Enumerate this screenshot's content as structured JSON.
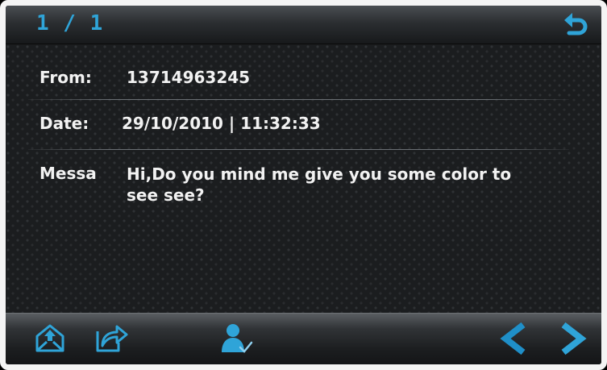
{
  "header": {
    "page_indicator": "1 / 1",
    "back_icon": "back-arrow-icon"
  },
  "message": {
    "from_label": "From:",
    "from_value": "13714963245",
    "date_label": "Date:",
    "date_value": "29/10/2010 | 11:32:33",
    "message_label": "Messa",
    "message_body": "Hi,Do you mind me give you some color to see see?"
  },
  "toolbar": {
    "icons": [
      "reply-envelope-icon",
      "forward-icon",
      "contact-icon",
      "prev-arrow-icon",
      "next-arrow-icon"
    ]
  },
  "colors": {
    "accent": "#2fa4d8",
    "background": "#1b1d1f",
    "text": "#f2f2f2"
  }
}
